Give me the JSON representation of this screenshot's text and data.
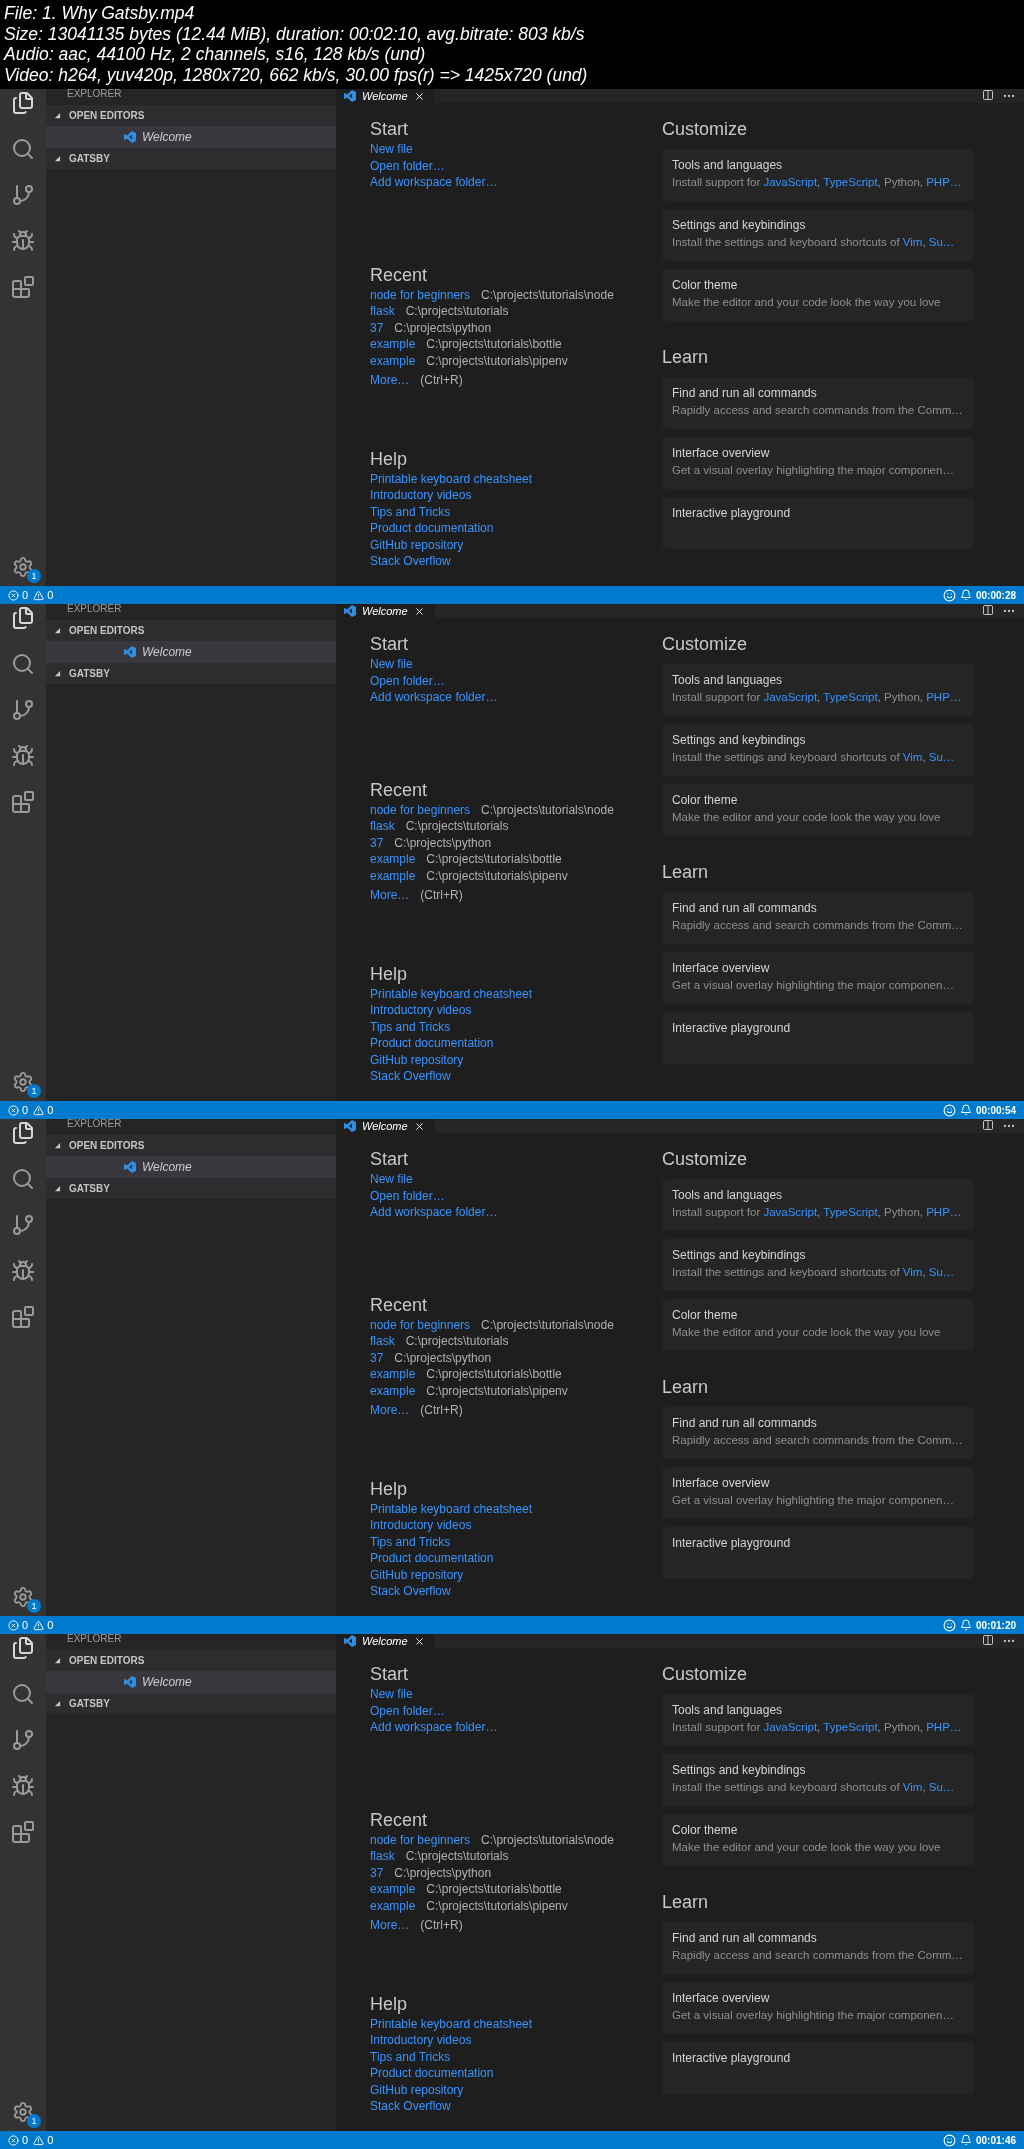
{
  "file_info": [
    "File: 1. Why Gatsby.mp4",
    "Size: 13041135 bytes (12.44 MiB), duration: 00:02:10, avg.bitrate: 803 kb/s",
    "Audio: aac, 44100 Hz, 2 channels, s16, 128 kb/s (und)",
    "Video: h264, yuv420p, 1280x720, 662 kb/s, 30.00 fps(r) => 1425x720 (und)"
  ],
  "frames": [
    {
      "timestamp": "00:00:28",
      "sidebar": {
        "title": "EXPLORER",
        "sections": [
          {
            "label": "OPEN EDITORS",
            "expanded": true,
            "items": [
              {
                "label": "Welcome",
                "selected": true
              }
            ]
          },
          {
            "label": "GATSBY",
            "expanded": true
          }
        ]
      },
      "settings_badge": "1",
      "tab": "Welcome",
      "start": {
        "heading": "Start",
        "links": [
          "New file",
          "Open folder…",
          "Add workspace folder…"
        ]
      },
      "recent": {
        "heading": "Recent",
        "items": [
          {
            "name": "node for beginners",
            "path": "C:\\projects\\tutorials\\node"
          },
          {
            "name": "flask",
            "path": "C:\\projects\\tutorials"
          },
          {
            "name": "37",
            "path": "C:\\projects\\python"
          },
          {
            "name": "example",
            "path": "C:\\projects\\tutorials\\bottle"
          },
          {
            "name": "example",
            "path": "C:\\projects\\tutorials\\pipenv"
          }
        ],
        "more": "More…",
        "shortcut": "(Ctrl+R)"
      },
      "help": {
        "heading": "Help",
        "links": [
          "Printable keyboard cheatsheet",
          "Introductory videos",
          "Tips and Tricks",
          "Product documentation",
          "GitHub repository",
          "Stack Overflow"
        ]
      },
      "customize": {
        "heading": "Customize",
        "cards": [
          {
            "title": "Tools and languages",
            "description": [
              {
                "text": "Install support for ",
                "link": false
              },
              {
                "text": "JavaScript",
                "link": true
              },
              {
                "text": ", ",
                "link": false
              },
              {
                "text": "TypeScript",
                "link": true
              },
              {
                "text": ", Python, ",
                "link": false
              },
              {
                "text": "PHP…",
                "link": true
              }
            ]
          },
          {
            "title": "Settings and keybindings",
            "description": [
              {
                "text": "Install the settings and keyboard shortcuts of ",
                "link": false
              },
              {
                "text": "Vim",
                "link": true
              },
              {
                "text": ", ",
                "link": false
              },
              {
                "text": "Su…",
                "link": true
              }
            ]
          },
          {
            "title": "Color theme",
            "description": [
              {
                "text": "Make the editor and your code look the way you love",
                "link": false
              }
            ]
          }
        ]
      },
      "learn": {
        "heading": "Learn",
        "cards": [
          {
            "title": "Find and run all commands",
            "description": [
              {
                "text": "Rapidly access and search commands from the Comm…",
                "link": false
              }
            ]
          },
          {
            "title": "Interface overview",
            "description": [
              {
                "text": "Get a visual overlay highlighting the major componen…",
                "link": false
              }
            ]
          },
          {
            "title": "Interactive playground"
          }
        ]
      },
      "status": {
        "errors": "0",
        "warnings": "0"
      }
    },
    {
      "timestamp": "00:00:54",
      "sidebar": {
        "title": "EXPLORER",
        "sections": [
          {
            "label": "OPEN EDITORS",
            "expanded": true,
            "items": [
              {
                "label": "Welcome",
                "selected": true
              }
            ]
          },
          {
            "label": "GATSBY",
            "expanded": true
          }
        ]
      },
      "settings_badge": "1",
      "tab": "Welcome",
      "start": {
        "heading": "Start",
        "links": [
          "New file",
          "Open folder…",
          "Add workspace folder…"
        ]
      },
      "recent": {
        "heading": "Recent",
        "items": [
          {
            "name": "node for beginners",
            "path": "C:\\projects\\tutorials\\node"
          },
          {
            "name": "flask",
            "path": "C:\\projects\\tutorials"
          },
          {
            "name": "37",
            "path": "C:\\projects\\python"
          },
          {
            "name": "example",
            "path": "C:\\projects\\tutorials\\bottle"
          },
          {
            "name": "example",
            "path": "C:\\projects\\tutorials\\pipenv"
          }
        ],
        "more": "More…",
        "shortcut": "(Ctrl+R)"
      },
      "help": {
        "heading": "Help",
        "links": [
          "Printable keyboard cheatsheet",
          "Introductory videos",
          "Tips and Tricks",
          "Product documentation",
          "GitHub repository",
          "Stack Overflow"
        ]
      },
      "customize": {
        "heading": "Customize",
        "cards": [
          {
            "title": "Tools and languages",
            "description": [
              {
                "text": "Install support for ",
                "link": false
              },
              {
                "text": "JavaScript",
                "link": true
              },
              {
                "text": ", ",
                "link": false
              },
              {
                "text": "TypeScript",
                "link": true
              },
              {
                "text": ", Python, ",
                "link": false
              },
              {
                "text": "PHP…",
                "link": true
              }
            ]
          },
          {
            "title": "Settings and keybindings",
            "description": [
              {
                "text": "Install the settings and keyboard shortcuts of ",
                "link": false
              },
              {
                "text": "Vim",
                "link": true
              },
              {
                "text": ", ",
                "link": false
              },
              {
                "text": "Su…",
                "link": true
              }
            ]
          },
          {
            "title": "Color theme",
            "description": [
              {
                "text": "Make the editor and your code look the way you love",
                "link": false
              }
            ]
          }
        ]
      },
      "learn": {
        "heading": "Learn",
        "cards": [
          {
            "title": "Find and run all commands",
            "description": [
              {
                "text": "Rapidly access and search commands from the Comm…",
                "link": false
              }
            ]
          },
          {
            "title": "Interface overview",
            "description": [
              {
                "text": "Get a visual overlay highlighting the major componen…",
                "link": false
              }
            ]
          },
          {
            "title": "Interactive playground"
          }
        ]
      },
      "status": {
        "errors": "0",
        "warnings": "0"
      }
    },
    {
      "timestamp": "00:01:20",
      "sidebar": {
        "title": "EXPLORER",
        "sections": [
          {
            "label": "OPEN EDITORS",
            "expanded": true,
            "items": [
              {
                "label": "Welcome",
                "selected": true
              }
            ]
          },
          {
            "label": "GATSBY",
            "expanded": true
          }
        ]
      },
      "settings_badge": "1",
      "tab": "Welcome",
      "start": {
        "heading": "Start",
        "links": [
          "New file",
          "Open folder…",
          "Add workspace folder…"
        ]
      },
      "recent": {
        "heading": "Recent",
        "items": [
          {
            "name": "node for beginners",
            "path": "C:\\projects\\tutorials\\node"
          },
          {
            "name": "flask",
            "path": "C:\\projects\\tutorials"
          },
          {
            "name": "37",
            "path": "C:\\projects\\python"
          },
          {
            "name": "example",
            "path": "C:\\projects\\tutorials\\bottle"
          },
          {
            "name": "example",
            "path": "C:\\projects\\tutorials\\pipenv"
          }
        ],
        "more": "More…",
        "shortcut": "(Ctrl+R)"
      },
      "help": {
        "heading": "Help",
        "links": [
          "Printable keyboard cheatsheet",
          "Introductory videos",
          "Tips and Tricks",
          "Product documentation",
          "GitHub repository",
          "Stack Overflow"
        ]
      },
      "customize": {
        "heading": "Customize",
        "cards": [
          {
            "title": "Tools and languages",
            "description": [
              {
                "text": "Install support for ",
                "link": false
              },
              {
                "text": "JavaScript",
                "link": true
              },
              {
                "text": ", ",
                "link": false
              },
              {
                "text": "TypeScript",
                "link": true
              },
              {
                "text": ", Python, ",
                "link": false
              },
              {
                "text": "PHP…",
                "link": true
              }
            ]
          },
          {
            "title": "Settings and keybindings",
            "description": [
              {
                "text": "Install the settings and keyboard shortcuts of ",
                "link": false
              },
              {
                "text": "Vim",
                "link": true
              },
              {
                "text": ", ",
                "link": false
              },
              {
                "text": "Su…",
                "link": true
              }
            ]
          },
          {
            "title": "Color theme",
            "description": [
              {
                "text": "Make the editor and your code look the way you love",
                "link": false
              }
            ]
          }
        ]
      },
      "learn": {
        "heading": "Learn",
        "cards": [
          {
            "title": "Find and run all commands",
            "description": [
              {
                "text": "Rapidly access and search commands from the Comm…",
                "link": false
              }
            ]
          },
          {
            "title": "Interface overview",
            "description": [
              {
                "text": "Get a visual overlay highlighting the major componen…",
                "link": false
              }
            ]
          },
          {
            "title": "Interactive playground"
          }
        ]
      },
      "status": {
        "errors": "0",
        "warnings": "0"
      }
    },
    {
      "timestamp": "00:01:46",
      "sidebar": {
        "title": "EXPLORER",
        "sections": [
          {
            "label": "OPEN EDITORS",
            "expanded": true,
            "items": [
              {
                "label": "Welcome",
                "selected": true
              }
            ]
          },
          {
            "label": "GATSBY",
            "expanded": true
          }
        ]
      },
      "settings_badge": "1",
      "tab": "Welcome",
      "start": {
        "heading": "Start",
        "links": [
          "New file",
          "Open folder…",
          "Add workspace folder…"
        ]
      },
      "recent": {
        "heading": "Recent",
        "items": [
          {
            "name": "node for beginners",
            "path": "C:\\projects\\tutorials\\node"
          },
          {
            "name": "flask",
            "path": "C:\\projects\\tutorials"
          },
          {
            "name": "37",
            "path": "C:\\projects\\python"
          },
          {
            "name": "example",
            "path": "C:\\projects\\tutorials\\bottle"
          },
          {
            "name": "example",
            "path": "C:\\projects\\tutorials\\pipenv"
          }
        ],
        "more": "More…",
        "shortcut": "(Ctrl+R)"
      },
      "help": {
        "heading": "Help",
        "links": [
          "Printable keyboard cheatsheet",
          "Introductory videos",
          "Tips and Tricks",
          "Product documentation",
          "GitHub repository",
          "Stack Overflow"
        ]
      },
      "customize": {
        "heading": "Customize",
        "cards": [
          {
            "title": "Tools and languages",
            "description": [
              {
                "text": "Install support for ",
                "link": false
              },
              {
                "text": "JavaScript",
                "link": true
              },
              {
                "text": ", ",
                "link": false
              },
              {
                "text": "TypeScript",
                "link": true
              },
              {
                "text": ", Python, ",
                "link": false
              },
              {
                "text": "PHP…",
                "link": true
              }
            ]
          },
          {
            "title": "Settings and keybindings",
            "description": [
              {
                "text": "Install the settings and keyboard shortcuts of ",
                "link": false
              },
              {
                "text": "Vim",
                "link": true
              },
              {
                "text": ", ",
                "link": false
              },
              {
                "text": "Su…",
                "link": true
              }
            ]
          },
          {
            "title": "Color theme",
            "description": [
              {
                "text": "Make the editor and your code look the way you love",
                "link": false
              }
            ]
          }
        ]
      },
      "learn": {
        "heading": "Learn",
        "cards": [
          {
            "title": "Find and run all commands",
            "description": [
              {
                "text": "Rapidly access and search commands from the Comm…",
                "link": false
              }
            ]
          },
          {
            "title": "Interface overview",
            "description": [
              {
                "text": "Get a visual overlay highlighting the major componen…",
                "link": false
              }
            ]
          },
          {
            "title": "Interactive playground"
          }
        ]
      },
      "status": {
        "errors": "0",
        "warnings": "0"
      }
    }
  ]
}
